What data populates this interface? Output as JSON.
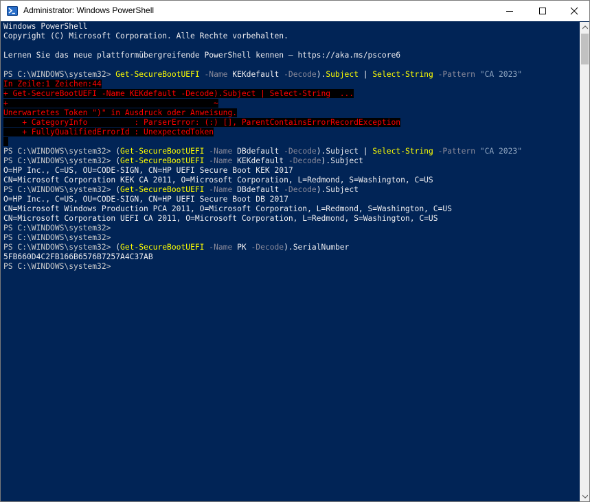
{
  "window": {
    "title": "Administrator: Windows PowerShell",
    "icon": "powershell-icon",
    "controls": [
      "minimize-icon",
      "maximize-icon",
      "close-icon"
    ],
    "colors": {
      "console_bg": "#012456",
      "command": "#ffff00",
      "error": "#ff0000",
      "text": "#eeedf0"
    }
  },
  "console": {
    "lines": [
      [
        {
          "t": "Windows PowerShell",
          "c": "def"
        }
      ],
      [
        {
          "t": "Copyright (C) Microsoft Corporation. Alle Rechte vorbehalten.",
          "c": "def"
        }
      ],
      [
        {
          "t": "",
          "c": "def"
        }
      ],
      [
        {
          "t": "Lernen Sie das neue plattformübergreifende PowerShell kennen – https://aka.ms/pscore6",
          "c": "def"
        }
      ],
      [
        {
          "t": "",
          "c": "def"
        }
      ],
      [
        {
          "t": "PS C:\\WINDOWS\\system32> ",
          "c": "prompt"
        },
        {
          "t": "Get-SecureBootUEFI",
          "c": "cmd"
        },
        {
          "t": " -Name ",
          "c": "param"
        },
        {
          "t": "KEKdefault",
          "c": "arg"
        },
        {
          "t": " -Decode",
          "c": "param"
        },
        {
          "t": ").",
          "c": "def"
        },
        {
          "t": "Subject",
          "c": "cmd"
        },
        {
          "t": " | ",
          "c": "def"
        },
        {
          "t": "Select-String",
          "c": "cmd"
        },
        {
          "t": " -Pattern ",
          "c": "param"
        },
        {
          "t": "\"CA 2023\"",
          "c": "str"
        }
      ],
      [
        {
          "t": "In Zeile:1 Zeichen:44",
          "c": "err"
        }
      ],
      [
        {
          "t": "+ Get-SecureBootUEFI -Name KEKdefault -Decode).Subject | Select-String  ...",
          "c": "err"
        }
      ],
      [
        {
          "t": "+                                            ~",
          "c": "err"
        }
      ],
      [
        {
          "t": "Unerwartetes Token \")\" in Ausdruck oder Anweisung.",
          "c": "err"
        }
      ],
      [
        {
          "t": "    + CategoryInfo          : ParserError: (:) [], ParentContainsErrorRecordException",
          "c": "err"
        }
      ],
      [
        {
          "t": "    + FullyQualifiedErrorId : UnexpectedToken",
          "c": "err"
        }
      ],
      [
        {
          "t": " ",
          "c": "blk"
        }
      ],
      [
        {
          "t": "PS C:\\WINDOWS\\system32> ",
          "c": "prompt"
        },
        {
          "t": "(",
          "c": "def"
        },
        {
          "t": "Get-SecureBootUEFI",
          "c": "cmd"
        },
        {
          "t": " -Name ",
          "c": "param"
        },
        {
          "t": "DBdefault",
          "c": "arg"
        },
        {
          "t": " -Decode",
          "c": "param"
        },
        {
          "t": ").Subject | ",
          "c": "def"
        },
        {
          "t": "Select-String",
          "c": "cmd"
        },
        {
          "t": " -Pattern ",
          "c": "param"
        },
        {
          "t": "\"CA 2023\"",
          "c": "str"
        }
      ],
      [
        {
          "t": "PS C:\\WINDOWS\\system32> ",
          "c": "prompt"
        },
        {
          "t": "(",
          "c": "def"
        },
        {
          "t": "Get-SecureBootUEFI",
          "c": "cmd"
        },
        {
          "t": " -Name ",
          "c": "param"
        },
        {
          "t": "KEKdefault",
          "c": "arg"
        },
        {
          "t": " -Decode",
          "c": "param"
        },
        {
          "t": ").Subject",
          "c": "def"
        }
      ],
      [
        {
          "t": "O=HP Inc., C=US, OU=CODE-SIGN, CN=HP UEFI Secure Boot KEK 2017",
          "c": "def"
        }
      ],
      [
        {
          "t": "CN=Microsoft Corporation KEK CA 2011, O=Microsoft Corporation, L=Redmond, S=Washington, C=US",
          "c": "def"
        }
      ],
      [
        {
          "t": "PS C:\\WINDOWS\\system32> ",
          "c": "prompt"
        },
        {
          "t": "(",
          "c": "def"
        },
        {
          "t": "Get-SecureBootUEFI",
          "c": "cmd"
        },
        {
          "t": " -Name ",
          "c": "param"
        },
        {
          "t": "DBdefault",
          "c": "arg"
        },
        {
          "t": " -Decode",
          "c": "param"
        },
        {
          "t": ").Subject",
          "c": "def"
        }
      ],
      [
        {
          "t": "O=HP Inc., C=US, OU=CODE-SIGN, CN=HP UEFI Secure Boot DB 2017",
          "c": "def"
        }
      ],
      [
        {
          "t": "CN=Microsoft Windows Production PCA 2011, O=Microsoft Corporation, L=Redmond, S=Washington, C=US",
          "c": "def"
        }
      ],
      [
        {
          "t": "CN=Microsoft Corporation UEFI CA 2011, O=Microsoft Corporation, L=Redmond, S=Washington, C=US",
          "c": "def"
        }
      ],
      [
        {
          "t": "PS C:\\WINDOWS\\system32>",
          "c": "prompt"
        }
      ],
      [
        {
          "t": "PS C:\\WINDOWS\\system32>",
          "c": "prompt"
        }
      ],
      [
        {
          "t": "PS C:\\WINDOWS\\system32> ",
          "c": "prompt"
        },
        {
          "t": "(",
          "c": "def"
        },
        {
          "t": "Get-SecureBootUEFI",
          "c": "cmd"
        },
        {
          "t": " -Name ",
          "c": "param"
        },
        {
          "t": "PK",
          "c": "arg"
        },
        {
          "t": " -Decode",
          "c": "param"
        },
        {
          "t": ").SerialNumber",
          "c": "def"
        }
      ],
      [
        {
          "t": "5FB660D4C2FB166B6576B7257A4C37AB",
          "c": "def"
        }
      ],
      [
        {
          "t": "PS C:\\WINDOWS\\system32>",
          "c": "prompt"
        }
      ]
    ]
  },
  "scrollbar": {
    "position": 0.0
  }
}
